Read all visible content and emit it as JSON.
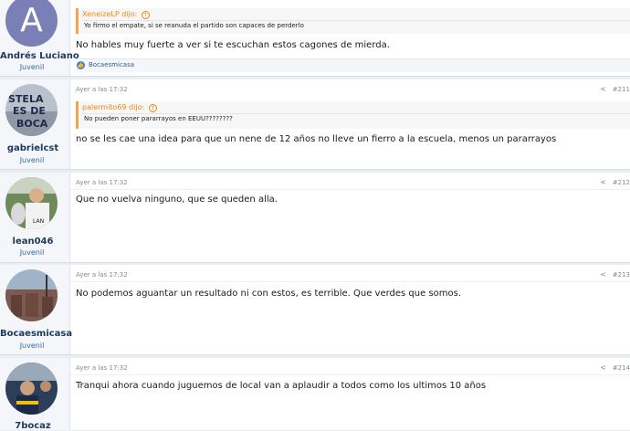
{
  "posts": [
    {
      "username": "Andrés Luciano",
      "role": "Juvenil",
      "avatar_letter": "A",
      "quote": {
        "author": "XeneizeLP dijo:",
        "text": "Yo firmo el empate, si se reanuda el partido son capaces de perderlo"
      },
      "body": "No hables muy fuerte a ver si te escuchan estos cagones de mierda.",
      "reaction": "Bocaesmicasa"
    },
    {
      "username": "gabrielcst",
      "role": "Juvenil",
      "date": "Ayer a las 17:32",
      "number": "#211",
      "quote": {
        "author": "palermito69 dijo:",
        "text": "No pueden poner pararrayos en EEUU????????"
      },
      "body": "no se les cae una idea para que un nene de 12 años no lleve un fierro a la escuela, menos un pararrayos"
    },
    {
      "username": "lean046",
      "role": "Juvenil",
      "date": "Ayer a las 17:32",
      "number": "#212",
      "body": "Que no vuelva ninguno, que se queden alla."
    },
    {
      "username": "Bocaesmicasa",
      "role": "Juvenil",
      "date": "Ayer a las 17:32",
      "number": "#213",
      "body": "No podemos aguantar un resultado ni con estos, es terrible. Que verdes que somos."
    },
    {
      "username": "7bocaz",
      "date": "Ayer a las 17:32",
      "number": "#214",
      "body": "Tranqui ahora cuando juguemos de local van a aplaudir a todos como los ultimos 10 años"
    }
  ],
  "icons": {
    "quote_arrow": "up-arrow-circle-icon",
    "share": "share-icon",
    "reaction": "like-icon"
  },
  "colors": {
    "quote_author": "#e88a10",
    "username": "#1d3a5c",
    "role": "#2c6aa0",
    "background": "#e9eef3"
  }
}
